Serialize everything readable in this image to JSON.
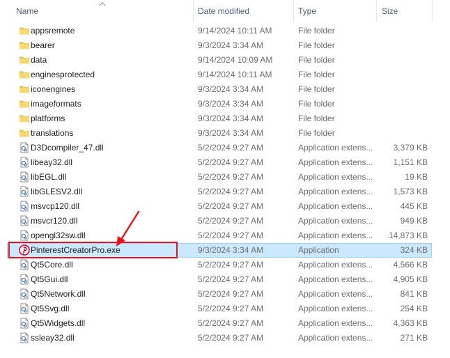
{
  "columns": {
    "name": "Name",
    "date": "Date modified",
    "type": "Type",
    "size": "Size"
  },
  "files": [
    {
      "name": "appsremote",
      "date": "9/14/2024 10:11 AM",
      "type": "File folder",
      "size": "",
      "icon": "folder-icon"
    },
    {
      "name": "bearer",
      "date": "9/3/2024 3:34 AM",
      "type": "File folder",
      "size": "",
      "icon": "folder-icon"
    },
    {
      "name": "data",
      "date": "9/14/2024 10:09 AM",
      "type": "File folder",
      "size": "",
      "icon": "folder-icon"
    },
    {
      "name": "enginesprotected",
      "date": "9/14/2024 10:11 AM",
      "type": "File folder",
      "size": "",
      "icon": "folder-icon"
    },
    {
      "name": "iconengines",
      "date": "9/3/2024 3:34 AM",
      "type": "File folder",
      "size": "",
      "icon": "folder-icon"
    },
    {
      "name": "imageformats",
      "date": "9/3/2024 3:34 AM",
      "type": "File folder",
      "size": "",
      "icon": "folder-icon"
    },
    {
      "name": "platforms",
      "date": "9/3/2024 3:34 AM",
      "type": "File folder",
      "size": "",
      "icon": "folder-icon"
    },
    {
      "name": "translations",
      "date": "9/3/2024 3:34 AM",
      "type": "File folder",
      "size": "",
      "icon": "folder-icon"
    },
    {
      "name": "D3Dcompiler_47.dll",
      "date": "5/2/2024 9:27 AM",
      "type": "Application extens...",
      "size": "3,379 KB",
      "icon": "dll-icon"
    },
    {
      "name": "libeay32.dll",
      "date": "5/2/2024 9:27 AM",
      "type": "Application extens...",
      "size": "1,151 KB",
      "icon": "dll-icon"
    },
    {
      "name": "libEGL.dll",
      "date": "5/2/2024 9:27 AM",
      "type": "Application extens...",
      "size": "19 KB",
      "icon": "dll-icon"
    },
    {
      "name": "libGLESV2.dll",
      "date": "5/2/2024 9:27 AM",
      "type": "Application extens...",
      "size": "1,573 KB",
      "icon": "dll-icon"
    },
    {
      "name": "msvcp120.dll",
      "date": "5/2/2024 9:27 AM",
      "type": "Application extens...",
      "size": "445 KB",
      "icon": "dll-icon"
    },
    {
      "name": "msvcr120.dll",
      "date": "5/2/2024 9:27 AM",
      "type": "Application extens...",
      "size": "949 KB",
      "icon": "dll-icon"
    },
    {
      "name": "opengl32sw.dll",
      "date": "5/2/2024 9:27 AM",
      "type": "Application extens...",
      "size": "14,873 KB",
      "icon": "dll-icon"
    },
    {
      "name": "PinterestCreatorPro.exe",
      "date": "9/3/2024 3:34 AM",
      "type": "Application",
      "size": "324 KB",
      "icon": "pinterest-icon",
      "selected": true
    },
    {
      "name": "Qt5Core.dll",
      "date": "5/2/2024 9:27 AM",
      "type": "Application extens...",
      "size": "4,566 KB",
      "icon": "dll-icon"
    },
    {
      "name": "Qt5Gui.dll",
      "date": "5/2/2024 9:27 AM",
      "type": "Application extens...",
      "size": "4,905 KB",
      "icon": "dll-icon"
    },
    {
      "name": "Qt5Network.dll",
      "date": "5/2/2024 9:27 AM",
      "type": "Application extens...",
      "size": "841 KB",
      "icon": "dll-icon"
    },
    {
      "name": "Qt5Svg.dll",
      "date": "5/2/2024 9:27 AM",
      "type": "Application extens...",
      "size": "254 KB",
      "icon": "dll-icon"
    },
    {
      "name": "Qt5Widgets.dll",
      "date": "5/2/2024 9:27 AM",
      "type": "Application extens...",
      "size": "4,363 KB",
      "icon": "dll-icon"
    },
    {
      "name": "ssleay32.dll",
      "date": "5/2/2024 9:27 AM",
      "type": "Application extens...",
      "size": "271 KB",
      "icon": "dll-icon"
    }
  ],
  "colors": {
    "selection_bg": "#cce8ff",
    "selection_border": "#99d1ff",
    "highlight_red": "#e8141b",
    "header_text": "#4c607a",
    "folder_yellow": "#f8d775",
    "pinterest_red": "#e60023"
  }
}
